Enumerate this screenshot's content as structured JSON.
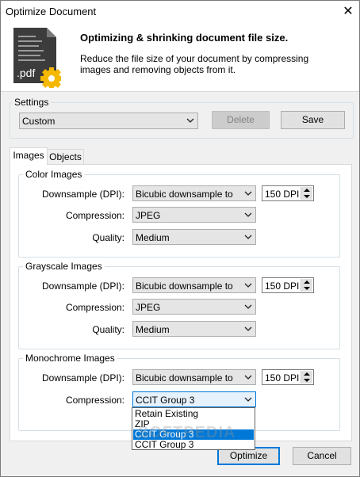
{
  "window": {
    "title": "Optimize Document",
    "close_glyph": "✕"
  },
  "header": {
    "icon_text": ".pdf",
    "title": "Optimizing & shrinking document file size.",
    "description": "Reduce the file size of your document by compressing images and removing objects from it."
  },
  "settings": {
    "label": "Settings",
    "preset": "Custom",
    "delete_label": "Delete",
    "save_label": "Save"
  },
  "tabs": [
    {
      "label": "Images"
    },
    {
      "label": "Objects"
    }
  ],
  "color_images": {
    "label": "Color Images",
    "downsample_label": "Downsample (DPI):",
    "downsample_value": "Bicubic downsample to",
    "dpi_value": "150 DPI",
    "compression_label": "Compression:",
    "compression_value": "JPEG",
    "quality_label": "Quality:",
    "quality_value": "Medium"
  },
  "grayscale_images": {
    "label": "Grayscale Images",
    "downsample_label": "Downsample (DPI):",
    "downsample_value": "Bicubic downsample to",
    "dpi_value": "150 DPI",
    "compression_label": "Compression:",
    "compression_value": "JPEG",
    "quality_label": "Quality:",
    "quality_value": "Medium"
  },
  "monochrome_images": {
    "label": "Monochrome Images",
    "downsample_label": "Downsample (DPI):",
    "downsample_value": "Bicubic downsample to",
    "dpi_value": "150 DPI",
    "compression_label": "Compression:",
    "compression_value": "CCIT Group 3",
    "dropdown_options": [
      "Retain Existing",
      "ZIP",
      "CCIT Group 3",
      "CCIT Group 3"
    ],
    "highlighted_option_index": 2
  },
  "footer": {
    "optimize_label": "Optimize",
    "cancel_label": "Cancel"
  },
  "watermark": "SOFTPEDIA",
  "colors": {
    "accent": "#0078d7",
    "gear": "#f5b800",
    "doc": "#3c3c3c"
  },
  "icons": [
    "close-icon",
    "pdf-document-icon",
    "gear-icon",
    "chevron-down-icon",
    "spin-up-icon",
    "spin-down-icon"
  ]
}
